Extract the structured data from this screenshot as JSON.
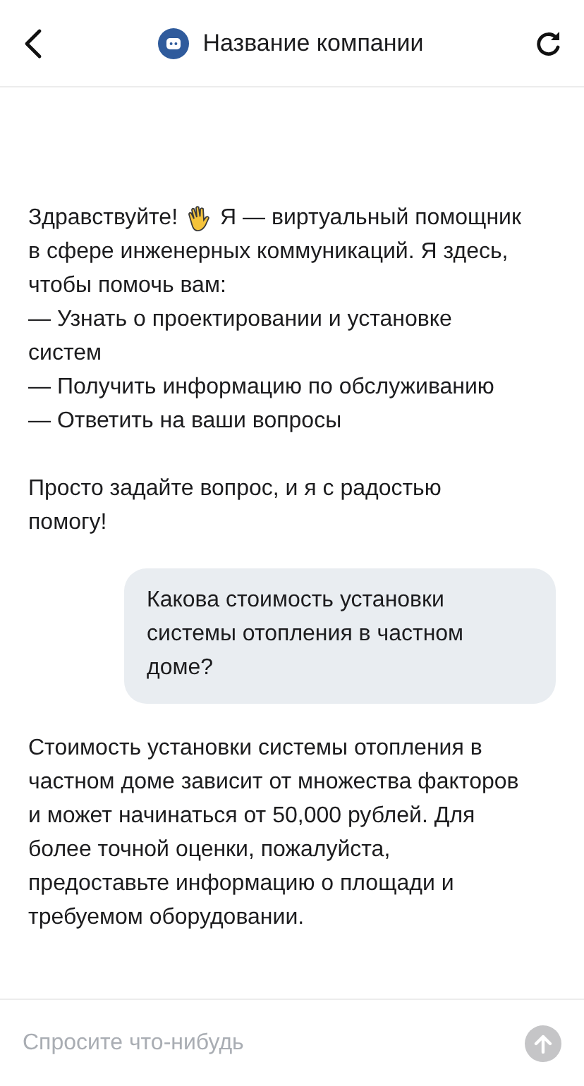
{
  "header": {
    "title": "Название компании"
  },
  "messages": [
    {
      "kind": "bot",
      "blocks": [
        {
          "kind": "greeting",
          "before": "Здравствуйте!",
          "after": "Я — виртуальный помощник"
        },
        {
          "kind": "cont",
          "text": "в сфере инженерных коммуникаций. Я здесь, чтобы помочь вам:"
        },
        {
          "kind": "item",
          "text": "— Узнать о проектировании и установке систем"
        },
        {
          "kind": "item",
          "text": "— Получить информацию по обслуживанию"
        },
        {
          "kind": "item",
          "text": "— Ответить на ваши вопросы"
        },
        {
          "kind": "para",
          "text": "Просто задайте вопрос, и я с радостью помогу!"
        }
      ]
    },
    {
      "kind": "user",
      "text": "Какова стоимость установки системы отопления в частном доме?"
    },
    {
      "kind": "bot",
      "blocks": [
        {
          "kind": "para",
          "text": "Стоимость установки системы отопления в частном доме зависит от множества факторов и может начинаться от 50,000 рублей. Для более точной оценки, пожалуйста, предоставьте информацию о площади и требуемом оборудовании."
        }
      ]
    }
  ],
  "composer": {
    "placeholder": "Спросите что-нибудь"
  }
}
